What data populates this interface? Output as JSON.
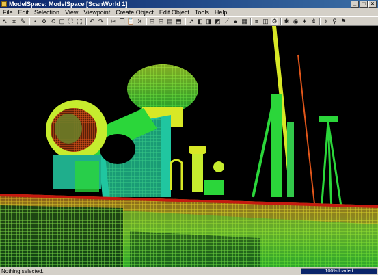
{
  "window": {
    "title": "ModelSpace: ModelSpace [ScanWorld 1]",
    "minimize_glyph": "_",
    "maximize_glyph": "□",
    "close_glyph": "×"
  },
  "menu": [
    "File",
    "Edit",
    "Selection",
    "View",
    "Viewpoint",
    "Create Object",
    "Edit Object",
    "Tools",
    "Help"
  ],
  "toolbar": {
    "icons": [
      {
        "name": "select-icon",
        "glyph": "↖"
      },
      {
        "name": "fence-icon",
        "glyph": "⌗"
      },
      {
        "name": "pencil-icon",
        "glyph": "✎"
      },
      {
        "name": "dot-icon",
        "glyph": "•"
      },
      {
        "name": "pan-icon",
        "glyph": "✥"
      },
      {
        "name": "rotate-icon",
        "glyph": "⟲"
      },
      {
        "name": "rectangle-icon",
        "glyph": "▢"
      },
      {
        "name": "fit-icon",
        "glyph": "⛶"
      },
      {
        "name": "box-icon",
        "glyph": "⬚"
      },
      {
        "name": "undo-icon",
        "glyph": "↶"
      },
      {
        "name": "redo-icon",
        "glyph": "↷"
      },
      {
        "name": "cut-icon",
        "glyph": "✂"
      },
      {
        "name": "copy-icon",
        "glyph": "❐"
      },
      {
        "name": "paste-icon",
        "glyph": "📋"
      },
      {
        "name": "delete-icon",
        "glyph": "✕"
      },
      {
        "name": "group-icon",
        "glyph": "⊞"
      },
      {
        "name": "ungroup-icon",
        "glyph": "⊟"
      },
      {
        "name": "layer-icon",
        "glyph": "▤"
      },
      {
        "name": "region-icon",
        "glyph": "⬒"
      },
      {
        "name": "measure-icon",
        "glyph": "↗"
      },
      {
        "name": "model-icon",
        "glyph": "◧"
      },
      {
        "name": "shaded-icon",
        "glyph": "◨"
      },
      {
        "name": "surface-icon",
        "glyph": "◩"
      },
      {
        "name": "brush-icon",
        "glyph": "⟋"
      },
      {
        "name": "sphere-icon",
        "glyph": "●"
      },
      {
        "name": "grid-icon",
        "glyph": "▦"
      },
      {
        "name": "stack-icon",
        "glyph": "≡"
      },
      {
        "name": "frames-icon",
        "glyph": "◫"
      },
      {
        "name": "scanner-icon",
        "glyph": "⚙"
      },
      {
        "name": "color-icon",
        "glyph": "✱"
      },
      {
        "name": "globe-icon",
        "glyph": "◉"
      },
      {
        "name": "render-icon",
        "glyph": "✦"
      },
      {
        "name": "station-icon",
        "glyph": "⛯"
      },
      {
        "name": "target-icon",
        "glyph": "⌖"
      },
      {
        "name": "walk-icon",
        "glyph": "⚲"
      },
      {
        "name": "fly-icon",
        "glyph": "⚑"
      }
    ]
  },
  "status": {
    "message": "Nothing selected.",
    "progress_label": "100% loaded",
    "progress_percent": 100
  },
  "colors": {
    "titlebar_start": "#0a246a",
    "titlebar_end": "#3a6ea5",
    "viewport_bg": "#000000",
    "points_green": "#2bd63a",
    "points_yellow": "#d8e826",
    "points_orange": "#e2561a",
    "points_red": "#c41a10",
    "points_cyan": "#20c6a0"
  }
}
